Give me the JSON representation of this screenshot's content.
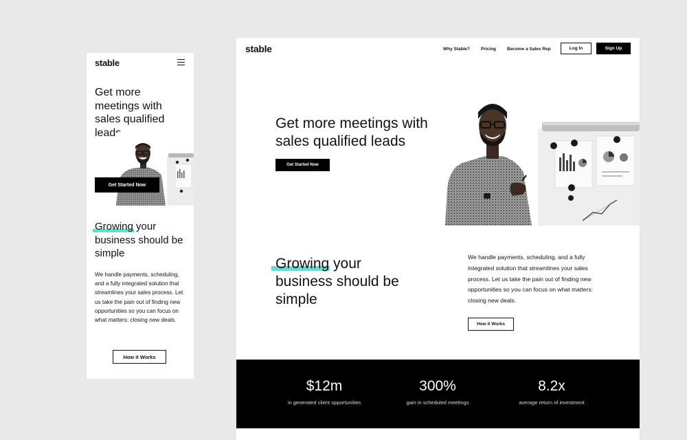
{
  "brand": {
    "logo": "stable"
  },
  "mobile": {
    "hero_title": "Get more meetings with sales qualified leads",
    "cta_label": "Get Started Now",
    "section": {
      "highlight_word": "Growing",
      "title_rest": " your business should be simple",
      "body": "We handle payments, scheduling, and a fully integrated solution that streamlines your sales process. Let us take the pain out of finding new opportunities so you can focus on what matters: closing new deals.",
      "button_label": "How it Works"
    }
  },
  "desktop": {
    "nav": [
      "Why Stable?",
      "Pricing",
      "Become a Sales Rep"
    ],
    "login_label": "Log In",
    "signup_label": "Sign Up",
    "hero_title": "Get more meetings with sales qualified leads",
    "cta_label": "Get Started Now",
    "section": {
      "highlight_word": "Growing",
      "title_rest": " your business should be simple",
      "body": "We handle payments, scheduling, and a fully integrated solution that streamlines your sales process. Let us take the pain out of finding new opportunities so you can focus on what matters: closing new deals.",
      "button_label": "How it Works"
    },
    "stats": [
      {
        "value": "$12m",
        "label": "in generated client opportunities"
      },
      {
        "value": "300%",
        "label": "gain in scheduled meetings"
      },
      {
        "value": "8.2x",
        "label": "average return of investment"
      }
    ]
  },
  "colors": {
    "accent": "#5de0cf",
    "background": "#e9e9e9",
    "dark": "#000000"
  }
}
